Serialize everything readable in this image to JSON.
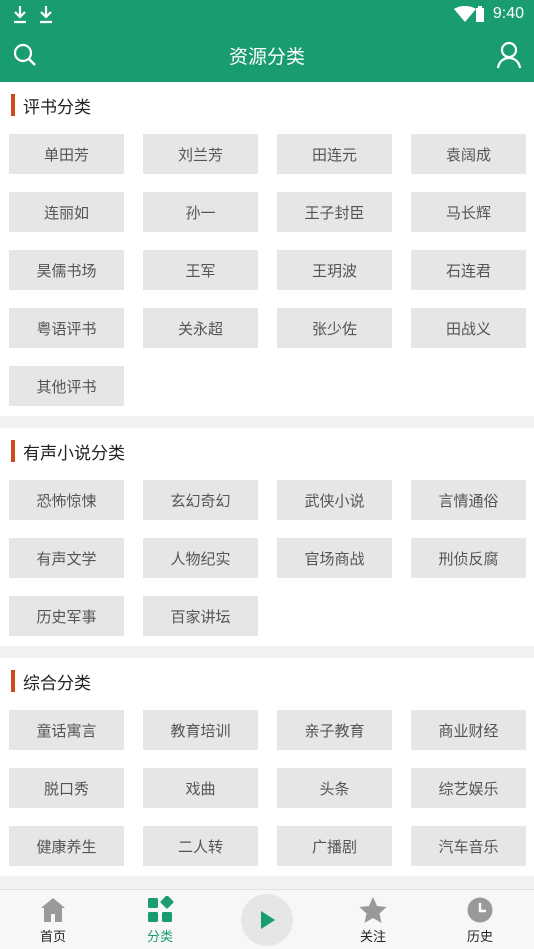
{
  "status_bar": {
    "time": "9:40"
  },
  "app_bar": {
    "title": "资源分类"
  },
  "sections": [
    {
      "title": "评书分类",
      "items": [
        "单田芳",
        "刘兰芳",
        "田连元",
        "袁阔成",
        "连丽如",
        "孙一",
        "王子封臣",
        "马长辉",
        "昊儒书场",
        "王军",
        "王玥波",
        "石连君",
        "粤语评书",
        "关永超",
        "张少佐",
        "田战义",
        "其他评书"
      ]
    },
    {
      "title": "有声小说分类",
      "items": [
        "恐怖惊悚",
        "玄幻奇幻",
        "武侠小说",
        "言情通俗",
        "有声文学",
        "人物纪实",
        "官场商战",
        "刑侦反腐",
        "历史军事",
        "百家讲坛"
      ]
    },
    {
      "title": "综合分类",
      "items": [
        "童话寓言",
        "教育培训",
        "亲子教育",
        "商业财经",
        "脱口秀",
        "戏曲",
        "头条",
        "综艺娱乐",
        "健康养生",
        "二人转",
        "广播剧",
        "汽车音乐"
      ]
    }
  ],
  "bottom_nav": {
    "home": "首页",
    "category": "分类",
    "follow": "关注",
    "history": "历史"
  },
  "colors": {
    "brand": "#1a9d6e",
    "section_bar": "#d14a1f",
    "tag_bg": "#e6e6e6"
  }
}
